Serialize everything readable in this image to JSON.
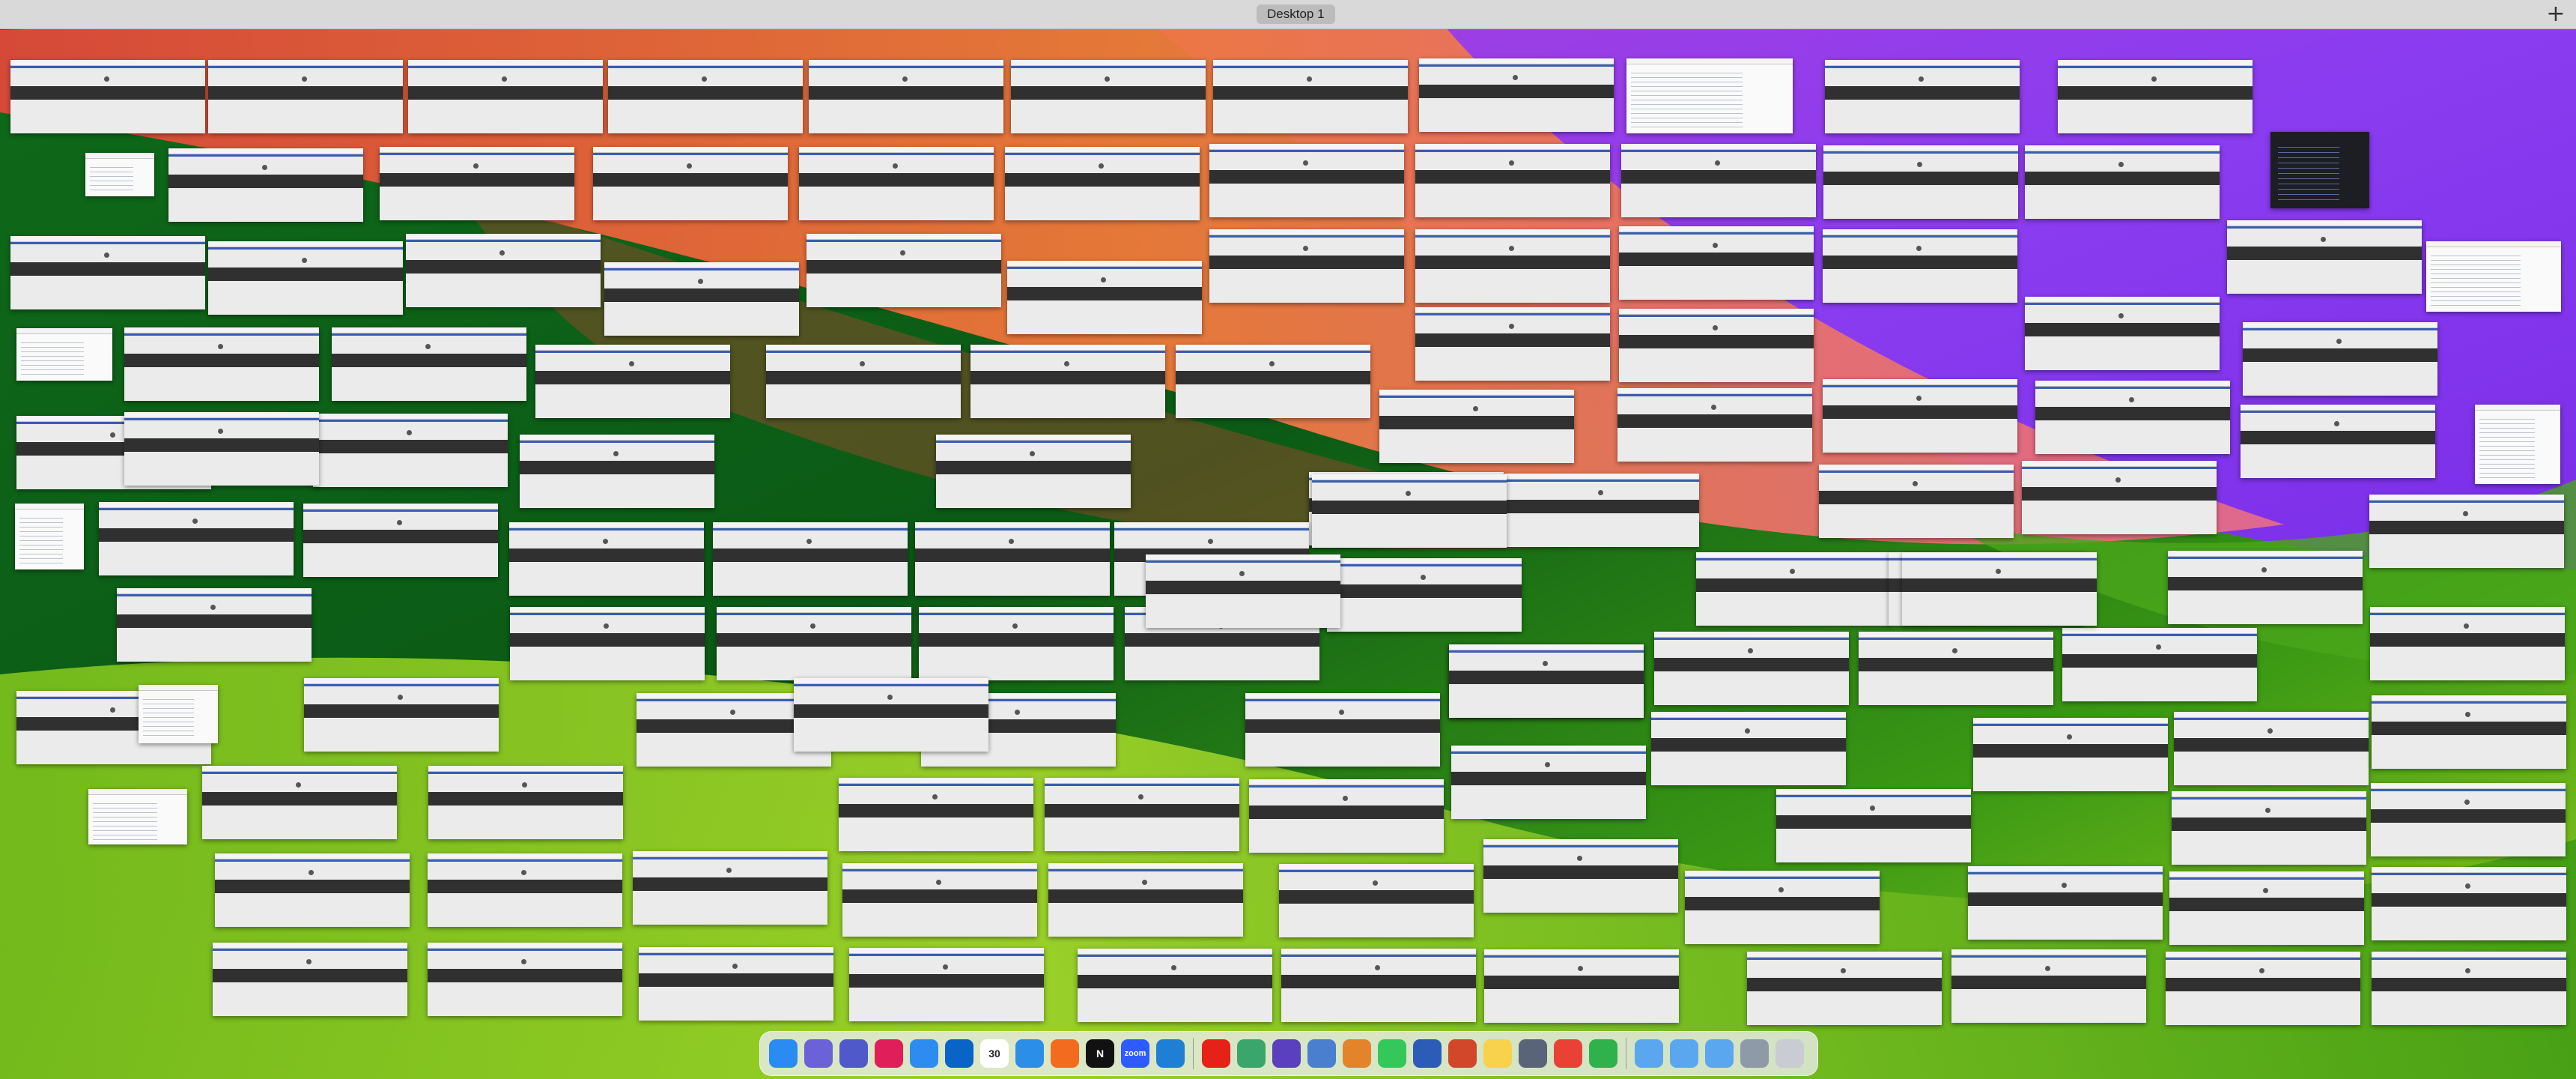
{
  "spaces_bar": {
    "desktop_label": "Desktop 1",
    "add_label": "+"
  },
  "wallpaper": {
    "colors": {
      "top_red": "#e0473a",
      "orange": "#f07a3a",
      "pink": "#e36b8c",
      "purple": "#8a3cf0",
      "dark_green": "#0b5a16",
      "green": "#3c9a14",
      "light_green": "#9fd21f"
    }
  },
  "windows_overview": {
    "window_style": "browser-window-thumbnail",
    "doc_thumbnails": 8,
    "dark_thumbnails": 1
  },
  "dock": {
    "apps": [
      {
        "name": "finder-icon",
        "label": "",
        "color": "#2a8bf2"
      },
      {
        "name": "launchpad-icon",
        "label": "",
        "color": "#6b62d8"
      },
      {
        "name": "teams-icon",
        "label": "",
        "color": "#5059c9"
      },
      {
        "name": "slack-icon",
        "label": "",
        "color": "#e01e5a"
      },
      {
        "name": "mail-icon",
        "label": "",
        "color": "#2e8cf0"
      },
      {
        "name": "outlook-icon",
        "label": "",
        "color": "#0a64c8"
      },
      {
        "name": "calendar-icon",
        "label": "30",
        "color": "#ffffff"
      },
      {
        "name": "safari-icon",
        "label": "",
        "color": "#2b8fe8"
      },
      {
        "name": "notes-orange-icon",
        "label": "",
        "color": "#f36b1c"
      },
      {
        "name": "notion-icon",
        "label": "N",
        "color": "#111111"
      },
      {
        "name": "zoom-icon",
        "label": "zoom",
        "color": "#2d5bff"
      },
      {
        "name": "vscode-icon",
        "label": "",
        "color": "#1f7fd4"
      }
    ],
    "apps_middle": [
      {
        "name": "youtube-icon",
        "label": "",
        "color": "#e62117"
      },
      {
        "name": "script-editor-icon",
        "label": "",
        "color": "#3aa66b"
      },
      {
        "name": "obsidian-icon",
        "label": "",
        "color": "#5a3fbf"
      },
      {
        "name": "preview-icon",
        "label": "",
        "color": "#4a7fd0"
      },
      {
        "name": "pixelmator-icon",
        "label": "",
        "color": "#e3842a"
      },
      {
        "name": "messages-icon",
        "label": "",
        "color": "#34c759"
      },
      {
        "name": "word-icon",
        "label": "",
        "color": "#2b5cb8"
      },
      {
        "name": "powerpoint-icon",
        "label": "",
        "color": "#d2472a"
      },
      {
        "name": "notes-icon",
        "label": "",
        "color": "#f7d24a"
      },
      {
        "name": "remote-desktop-icon",
        "label": "",
        "color": "#5a6478"
      },
      {
        "name": "chrome-icon",
        "label": "",
        "color": "#e94235"
      },
      {
        "name": "numbers-icon",
        "label": "",
        "color": "#2fb24c"
      }
    ],
    "folders": [
      {
        "name": "applications-folder-icon",
        "label": "",
        "color": "#5ba7ef"
      },
      {
        "name": "documents-folder-icon",
        "label": "",
        "color": "#5ba7ef"
      },
      {
        "name": "downloads-folder-icon",
        "label": "",
        "color": "#5ba7ef"
      },
      {
        "name": "screenshots-stack-icon",
        "label": "",
        "color": "#8f9aa8"
      },
      {
        "name": "trash-icon",
        "label": "",
        "color": "#c9ccd2"
      }
    ]
  }
}
